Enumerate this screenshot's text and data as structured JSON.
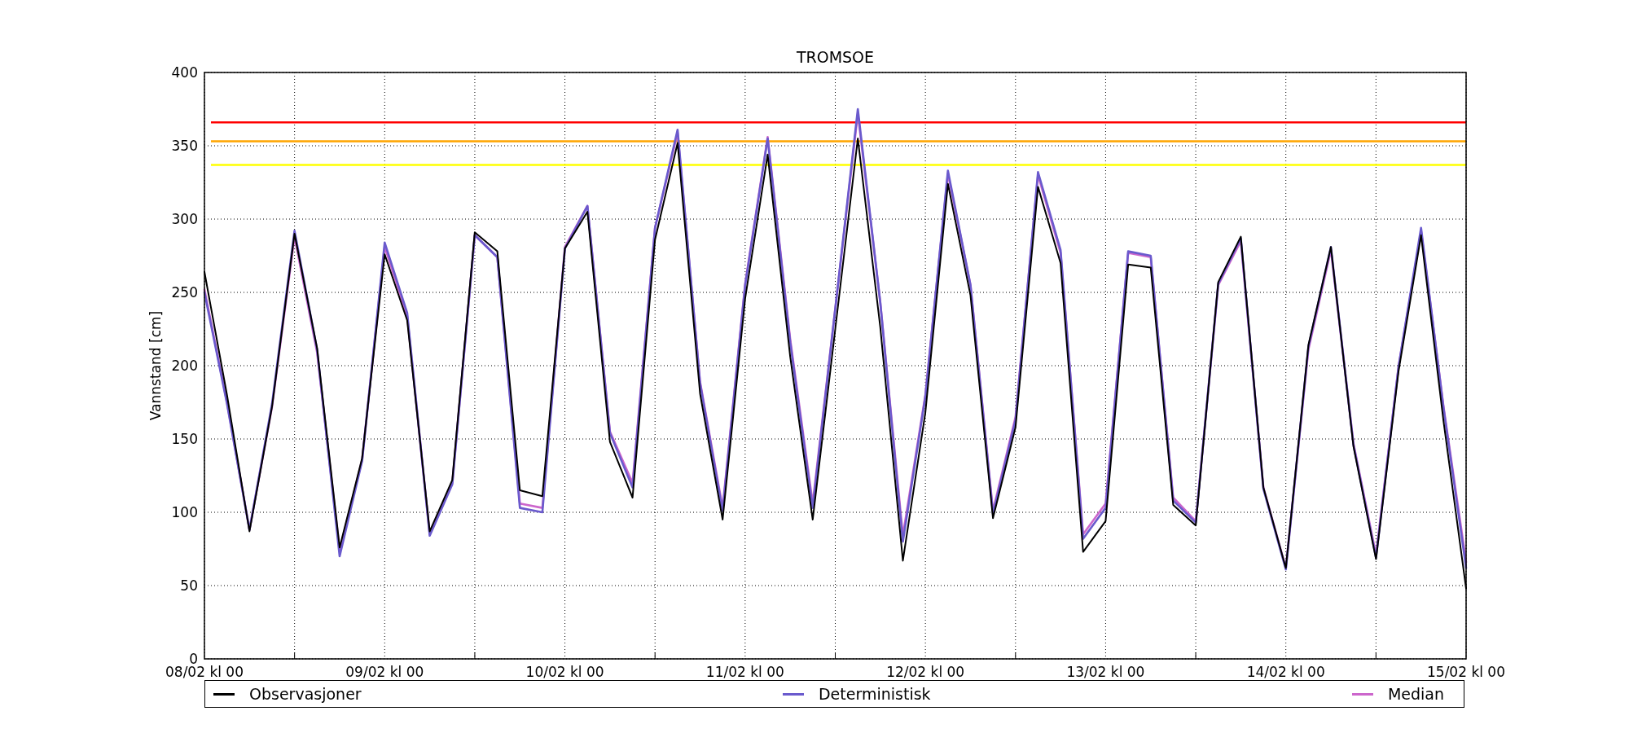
{
  "chart_data": {
    "type": "line",
    "title": "TROMSOE",
    "ylabel": "Vannstand [cm]",
    "categories": [
      "08/02 kl 00",
      null,
      null,
      null,
      null,
      null,
      null,
      null,
      "09/02 kl 00",
      null,
      null,
      null,
      null,
      null,
      null,
      null,
      "10/02 kl 00",
      null,
      null,
      null,
      null,
      null,
      null,
      null,
      "11/02 kl 00",
      null,
      null,
      null,
      null,
      null,
      null,
      null,
      "12/02 kl 00",
      null,
      null,
      null,
      null,
      null,
      null,
      null,
      "13/02 kl 00",
      null,
      null,
      null,
      null,
      null,
      null,
      null,
      "14/02 kl 00",
      null,
      null,
      null,
      null,
      null,
      null,
      null,
      "15/02 kl 00"
    ],
    "series": [
      {
        "name": "Observasjoner",
        "color": "#000000",
        "values": [
          264,
          180,
          87,
          172,
          290,
          212,
          76,
          137,
          276,
          231,
          87,
          122,
          291,
          278,
          115,
          111,
          280,
          305,
          148,
          110,
          286,
          352,
          181,
          95,
          246,
          344,
          206,
          95,
          225,
          355,
          226,
          67,
          168,
          324,
          248,
          96,
          158,
          322,
          270,
          73,
          94,
          269,
          267,
          105,
          91,
          257,
          288,
          117,
          62,
          214,
          281,
          145,
          68,
          196,
          289,
          162,
          48
        ]
      },
      {
        "name": "Deterministisk",
        "color": "#6a5acd",
        "values": [
          250,
          174,
          88,
          174,
          292,
          211,
          70,
          135,
          284,
          236,
          84,
          119,
          289,
          274,
          103,
          100,
          280,
          309,
          154,
          117,
          294,
          361,
          188,
          101,
          255,
          355,
          216,
          103,
          239,
          375,
          243,
          80,
          179,
          333,
          255,
          99,
          163,
          332,
          279,
          82,
          103,
          278,
          275,
          108,
          93,
          256,
          287,
          116,
          61,
          213,
          281,
          146,
          69,
          199,
          294,
          171,
          62
        ]
      },
      {
        "name": "Median",
        "color": "#cc66cc",
        "values": [
          252,
          175,
          88,
          172,
          288,
          209,
          74,
          136,
          281,
          234,
          85,
          120,
          289,
          274,
          106,
          103,
          281,
          309,
          155,
          120,
          294,
          359,
          189,
          103,
          256,
          356,
          218,
          106,
          239,
          372,
          243,
          84,
          180,
          331,
          255,
          101,
          165,
          330,
          277,
          85,
          106,
          277,
          274,
          110,
          94,
          255,
          285,
          117,
          62,
          211,
          279,
          147,
          71,
          199,
          292,
          172,
          66
        ]
      }
    ],
    "ylim": [
      0,
      400
    ],
    "grid": true,
    "yticks": [
      0,
      50,
      100,
      150,
      200,
      250,
      300,
      350,
      400
    ],
    "ref_lines": [
      {
        "axis": "y",
        "value": 366,
        "color": "#ff0000"
      },
      {
        "axis": "y",
        "value": 353,
        "color": "#ffa500"
      },
      {
        "axis": "y",
        "value": 337,
        "color": "#ffff00"
      }
    ]
  }
}
